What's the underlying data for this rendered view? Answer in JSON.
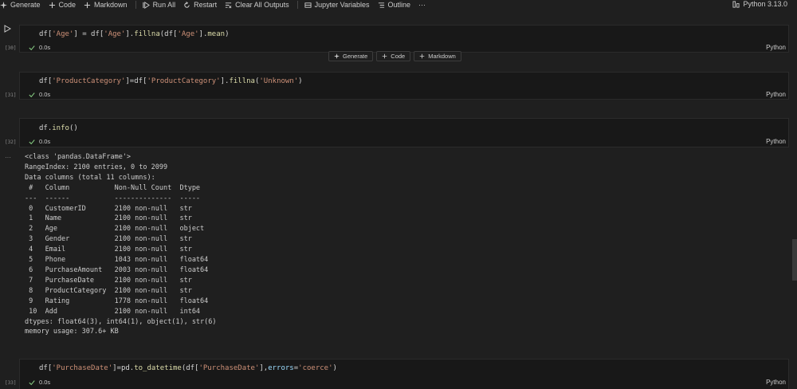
{
  "toolbar": {
    "generate": "Generate",
    "code": "Code",
    "markdown": "Markdown",
    "run_all": "Run All",
    "restart": "Restart",
    "clear_all_outputs": "Clear All Outputs",
    "jupyter_variables": "Jupyter Variables",
    "outline": "Outline",
    "more": "···",
    "kernel": "Python 3.13.0"
  },
  "insert_bar": {
    "generate": "Generate",
    "code": "Code",
    "markdown": "Markdown"
  },
  "cells": [
    {
      "count": "[30]",
      "status": "0.0s",
      "lang": "Python"
    },
    {
      "count": "[31]",
      "status": "0.0s",
      "lang": "Python"
    },
    {
      "count": "[32]",
      "status": "0.0s",
      "lang": "Python"
    },
    {
      "count": "[33]",
      "status": "0.0s",
      "lang": "Python"
    }
  ],
  "code": {
    "c30": {
      "a": "df[",
      "b": "'Age'",
      "c": "] = df[",
      "d": "'Age'",
      "e": "].",
      "f": "fillna",
      "g": "(df[",
      "h": "'Age'",
      "i": "].",
      "j": "mean",
      "k": ")"
    },
    "c31": {
      "a": "df[",
      "b": "'ProductCategory'",
      "c": "]=df[",
      "d": "'ProductCategory'",
      "e": "].",
      "f": "fillna",
      "g": "(",
      "h": "'Unknown'",
      "i": ")"
    },
    "c32": {
      "a": "df.",
      "b": "info",
      "c": "()"
    },
    "c33": {
      "a": "df[",
      "b": "'PurchaseDate'",
      "c": "]=pd.",
      "d": "to_datetime",
      "e": "(df[",
      "f": "'PurchaseDate'",
      "g": "],",
      "h": "errors",
      "i": "=",
      "j": "'coerce'",
      "k": ")"
    }
  },
  "output": {
    "dots": "···",
    "lines": [
      "<class 'pandas.DataFrame'>",
      "RangeIndex: 2100 entries, 0 to 2099",
      "Data columns (total 11 columns):",
      " #   Column           Non-Null Count  Dtype  ",
      "---  ------           --------------  -----  ",
      " 0   CustomerID       2100 non-null   str    ",
      " 1   Name             2100 non-null   str    ",
      " 2   Age              2100 non-null   object ",
      " 3   Gender           2100 non-null   str    ",
      " 4   Email            2100 non-null   str    ",
      " 5   Phone            1043 non-null   float64",
      " 6   PurchaseAmount   2003 non-null   float64",
      " 7   PurchaseDate     2100 non-null   str    ",
      " 8   ProductCategory  2100 non-null   str    ",
      " 9   Rating           1778 non-null   float64",
      " 10  Add              2100 non-null   int64  ",
      "dtypes: float64(3), int64(1), object(1), str(6)",
      "memory usage: 307.6+ KB"
    ]
  },
  "icons": {
    "generate": "sparkle-icon",
    "code": "plus-icon",
    "markdown": "plus-icon",
    "run_all": "play-all-icon",
    "restart": "restart-icon",
    "clear": "clear-all-icon",
    "variables": "variables-icon",
    "outline": "outline-icon",
    "kernel": "kernel-icon",
    "status": "check-icon",
    "run": "run-icon"
  },
  "colors": {
    "background": "#1f1f1f",
    "cell": "#181818",
    "string": "#ce9178",
    "function": "#dcdcaa",
    "check": "#89d185"
  }
}
